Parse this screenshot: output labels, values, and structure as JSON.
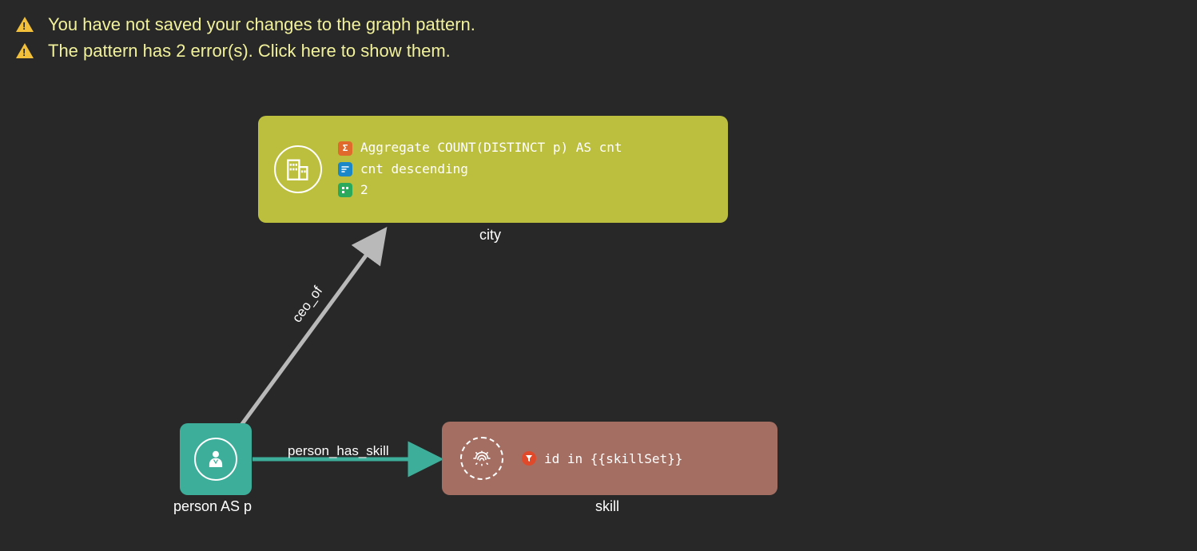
{
  "warnings": [
    {
      "text": "You have not saved your changes to the graph pattern."
    },
    {
      "text": "The pattern has 2 error(s). Click here to show them."
    }
  ],
  "nodes": {
    "city": {
      "label": "city",
      "color": "#bcbf3d",
      "icon": "building-icon",
      "properties": {
        "aggregate": "Aggregate COUNT(DISTINCT p) AS cnt",
        "sort": "cnt descending",
        "limit": "2"
      }
    },
    "person": {
      "label": "person AS p",
      "color": "#3dae9a",
      "icon": "person-icon"
    },
    "skill": {
      "label": "skill",
      "color": "#a46e62",
      "icon": "fingerprint-icon",
      "properties": {
        "filter": "id in {{skillSet}}"
      }
    }
  },
  "edges": {
    "ceo_of": {
      "label": "ceo_of",
      "from": "person",
      "to": "city",
      "color": "#b9b9b9"
    },
    "person_has_skill": {
      "label": "person_has_skill",
      "from": "person",
      "to": "skill",
      "color": "#3dae9a"
    }
  }
}
